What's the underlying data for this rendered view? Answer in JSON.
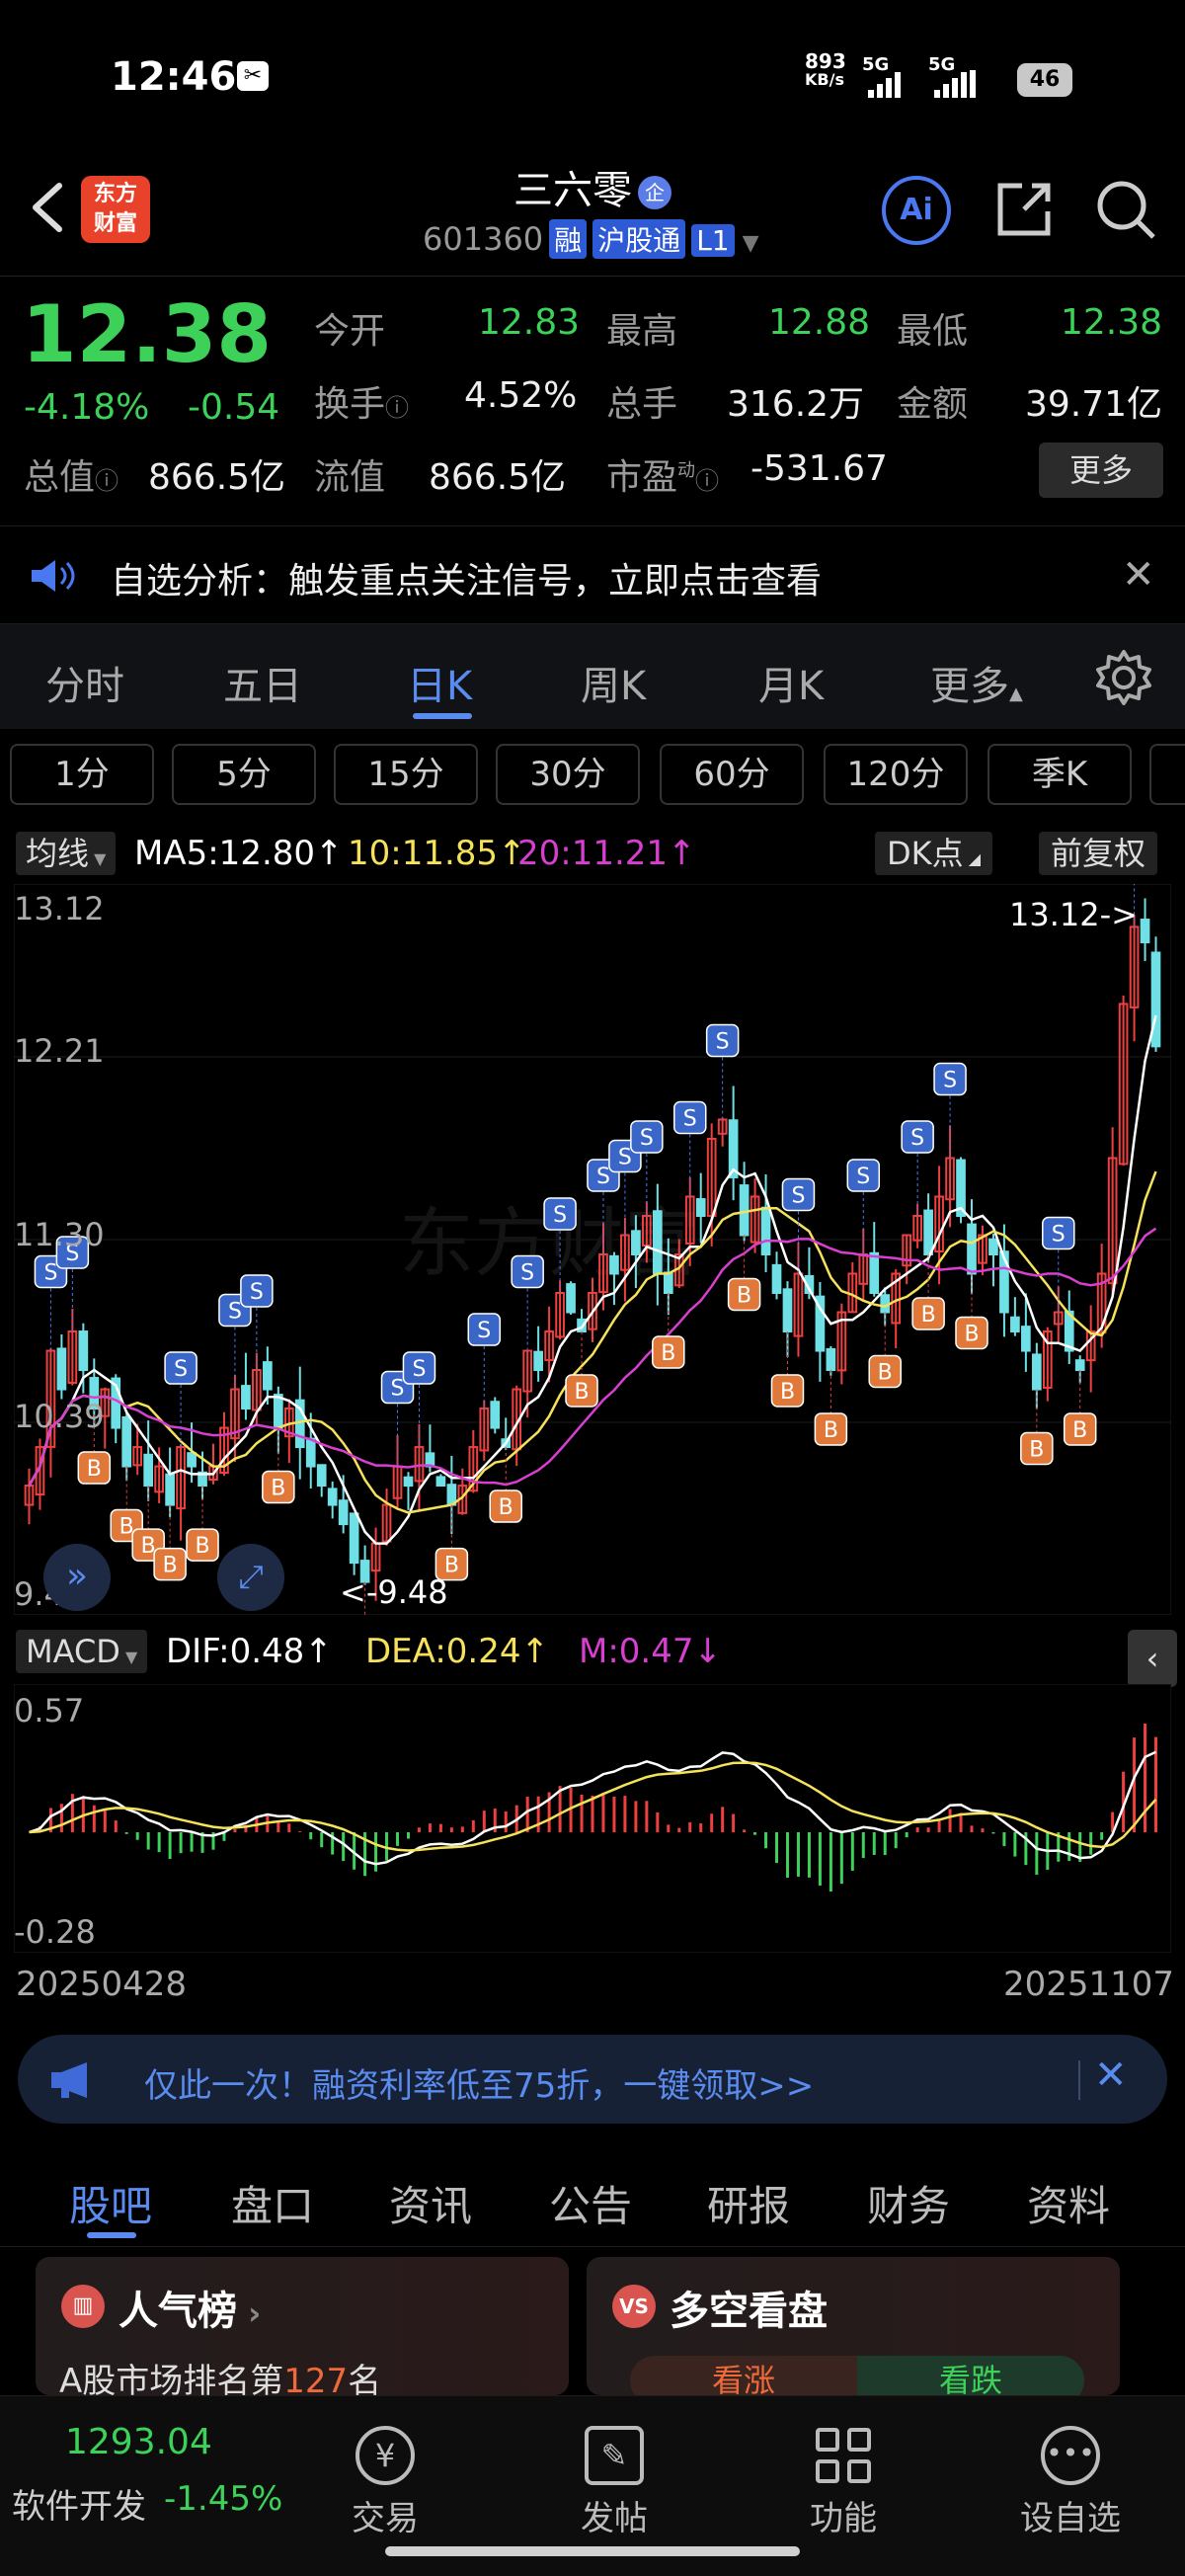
{
  "status": {
    "time": "12:46",
    "speed_num": "893",
    "speed_unit": "KB/s",
    "net1": "5G",
    "net2": "5G",
    "battery": "46"
  },
  "header": {
    "logo_line1": "东方",
    "logo_line2": "财富",
    "stock_name": "三六零",
    "qi_badge": "企",
    "code": "601360",
    "tags": [
      "融",
      "沪股通",
      "L1"
    ]
  },
  "quote": {
    "price": "12.38",
    "change_pct": "-4.18%",
    "change_amt": "-0.54",
    "open_label": "今开",
    "open": "12.83",
    "high_label": "最高",
    "high": "12.88",
    "low_label": "最低",
    "low": "12.38",
    "turnover_label": "换手",
    "turnover": "4.52%",
    "volume_label": "总手",
    "volume": "316.2万",
    "amount_label": "金额",
    "amount": "39.71亿",
    "mcap_label": "总值",
    "mcap": "866.5亿",
    "float_label": "流值",
    "float": "866.5亿",
    "pe_label": "市盈",
    "pe_sup": "动",
    "pe": "-531.67",
    "more": "更多"
  },
  "banner1": {
    "text": "自选分析：触发重点关注信号，立即点击查看"
  },
  "tabs": [
    "分时",
    "五日",
    "日K",
    "周K",
    "月K",
    "更多"
  ],
  "active_tab": "日K",
  "periods": [
    "1分",
    "5分",
    "15分",
    "30分",
    "60分",
    "120分",
    "季K"
  ],
  "ma_bar": {
    "selector": "均线",
    "ma5": "MA5:12.80",
    "ma10": "10:11.85",
    "ma20": "20:11.21",
    "dk": "DK点",
    "fq": "前复权"
  },
  "kchart_labels": {
    "y_top": "13.12",
    "y2": "12.21",
    "y3": "11.30",
    "y4": "10.39",
    "y_bottom": "9.48",
    "max_note": "13.12->",
    "min_note": "<-9.48",
    "watermark": "东方财富"
  },
  "macd_bar": {
    "selector": "MACD",
    "dif": "DIF:0.48",
    "dea": "DEA:0.24",
    "m": "M:0.47"
  },
  "macd_labels": {
    "top": "0.57",
    "bottom": "-0.28"
  },
  "dates": {
    "start": "20250428",
    "end": "20251107"
  },
  "banner2": {
    "text": "仅此一次！融资利率低至75折，一键领取>>"
  },
  "tabs2": [
    "股吧",
    "盘口",
    "资讯",
    "公告",
    "研报",
    "财务",
    "资料"
  ],
  "active_tab2": "股吧",
  "cards": {
    "pop_title": "人气榜",
    "pop_sub_prefix": "A股市场排名第",
    "pop_rank": "127",
    "pop_sub_suffix": "名",
    "ls_title": "多空看盘",
    "bull": "看涨",
    "bear": "看跌"
  },
  "bottom": {
    "index_value": "1293.04",
    "index_name": "软件开发",
    "index_change": "-1.45%",
    "nav": [
      "交易",
      "发帖",
      "功能",
      "设自选"
    ]
  },
  "colors": {
    "up": "#ef4040",
    "down": "#3dd15a",
    "accent": "#5a8cf0",
    "ma5": "#ffffff",
    "ma10": "#f5e25a",
    "ma20": "#d83fd0",
    "candle_down": "#6fe0e6"
  },
  "chart_data": {
    "type": "candlestick",
    "x_range": [
      "20250428",
      "20251107"
    ],
    "ylim": [
      9.48,
      13.12
    ],
    "close": [
      10.1,
      10.3,
      10.8,
      10.6,
      10.9,
      10.7,
      10.5,
      10.6,
      10.4,
      10.2,
      10.3,
      10.1,
      10.2,
      10.0,
      10.3,
      10.2,
      10.1,
      10.2,
      10.4,
      10.6,
      10.5,
      10.7,
      10.6,
      10.4,
      10.5,
      10.3,
      10.2,
      10.1,
      10.0,
      9.9,
      9.7,
      9.6,
      9.8,
      10.0,
      10.2,
      10.1,
      10.3,
      10.2,
      10.1,
      10.0,
      10.1,
      10.3,
      10.5,
      10.4,
      10.3,
      10.6,
      10.8,
      10.7,
      10.9,
      11.1,
      11.0,
      10.9,
      11.1,
      11.3,
      11.2,
      11.4,
      11.3,
      11.5,
      11.2,
      11.1,
      11.3,
      11.6,
      11.5,
      11.9,
      12.0,
      11.7,
      11.4,
      11.6,
      11.3,
      11.1,
      10.9,
      11.2,
      11.1,
      10.8,
      10.7,
      11.0,
      11.2,
      11.3,
      11.1,
      11.0,
      11.2,
      11.4,
      11.5,
      11.3,
      11.6,
      11.8,
      11.5,
      11.2,
      11.4,
      11.3,
      11.0,
      10.9,
      10.8,
      10.6,
      10.9,
      11.0,
      10.8,
      10.7,
      10.9,
      11.2,
      11.8,
      12.6,
      13.0,
      12.92,
      12.38
    ]
  }
}
